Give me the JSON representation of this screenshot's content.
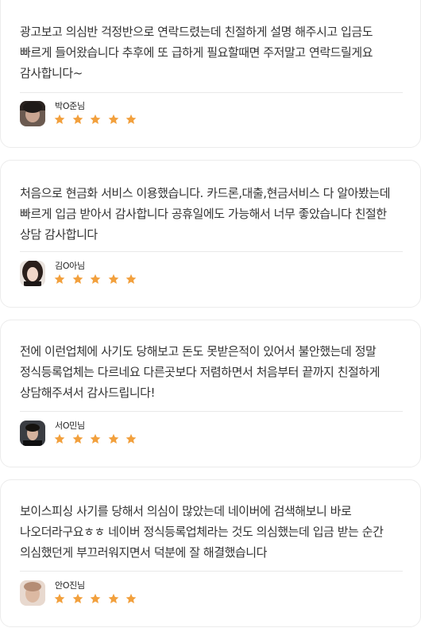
{
  "colors": {
    "star": "#f2a03d",
    "text": "#333333",
    "border": "#ececec"
  },
  "reviews": [
    {
      "text": "광고보고 의심반 걱정반으로 연락드렸는데 친절하게 설명 해주시고 입금도 빠르게 들어왔습니다  추후에 또 급하게 필요할때면 주저말고 연락드릴게요 감사합니다~",
      "author": "박O준님",
      "rating": 5
    },
    {
      "text": "처음으로 현금화 서비스 이용했습니다. 카드론,대출,현금서비스 다 알아봤는데 빠르게 입금 받아서 감사합니다 공휴일에도 가능해서 너무 좋았습니다 친절한 상담 감사합니다",
      "author": "김O아님",
      "rating": 5
    },
    {
      "text": "전에 이런업체에 사기도 당해보고 돈도 못받은적이 있어서 불안했는데 정말 정식등록업체는 다르네요 다른곳보다 저렴하면서  처음부터 끝까지 친절하게 상담해주셔서 감사드립니다!",
      "author": "서O민님",
      "rating": 5
    },
    {
      "text": "보이스피싱 사기를 당해서 의심이 많았는데 네이버에 검색해보니 바로 나오더라구요ㅎㅎ  네이버 정식등록업체라는 것도 의심했는데 입금 받는 순간 의심했던게 부끄러워지면서 덕분에 잘 해결했습니다",
      "author": "안O진님",
      "rating": 5
    }
  ]
}
